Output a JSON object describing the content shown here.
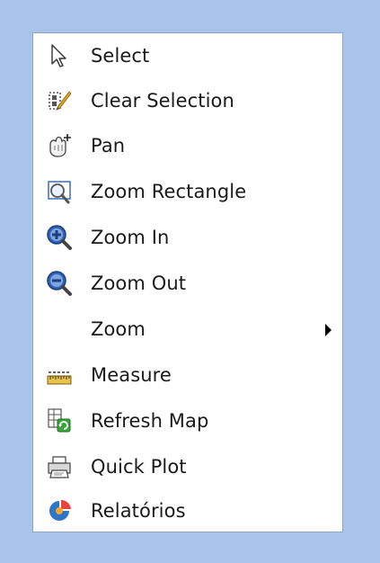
{
  "menu": {
    "items": [
      {
        "label": "Select",
        "icon": "cursor-arrow-icon"
      },
      {
        "label": "Clear Selection",
        "icon": "clear-selection-icon"
      },
      {
        "label": "Pan",
        "icon": "pan-hand-icon"
      },
      {
        "label": "Zoom Rectangle",
        "icon": "zoom-rectangle-icon"
      },
      {
        "label": "Zoom In",
        "icon": "zoom-in-icon"
      },
      {
        "label": "Zoom Out",
        "icon": "zoom-out-icon"
      },
      {
        "label": "Zoom",
        "icon": "none",
        "has_submenu": true
      },
      {
        "label": "Measure",
        "icon": "ruler-icon"
      },
      {
        "label": "Refresh Map",
        "icon": "refresh-map-icon"
      },
      {
        "label": "Quick Plot",
        "icon": "quick-plot-icon"
      },
      {
        "label": "Relatórios",
        "icon": "reports-icon"
      }
    ]
  },
  "colors": {
    "background": "#a9c4ea",
    "menu_border": "#8aa6cf",
    "zoom_icon_blue": "#2f63b8"
  }
}
